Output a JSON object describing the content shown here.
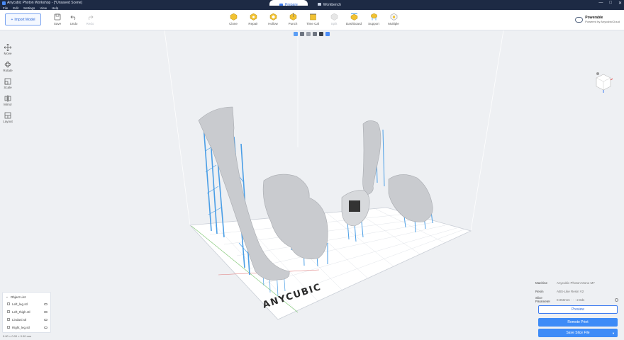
{
  "window": {
    "title": "Anycubic Photon Workshop - [*Unsaved Scene]",
    "tabs": [
      {
        "label": "Prepare",
        "active": true
      },
      {
        "label": "Workbench",
        "active": false
      }
    ],
    "controls": [
      "—",
      "□",
      "✕"
    ]
  },
  "menu": [
    "File",
    "Edit",
    "Settings",
    "View",
    "Help"
  ],
  "toolbar": {
    "import_label": "Import Model",
    "left_tools": [
      {
        "label": "Save",
        "icon": "save-icon",
        "enabled": true
      },
      {
        "label": "Undo",
        "icon": "undo-icon",
        "enabled": true
      },
      {
        "label": "Redo",
        "icon": "redo-icon",
        "enabled": false
      }
    ],
    "center_tools": [
      {
        "label": "Clone",
        "icon": "clone-icon",
        "enabled": true
      },
      {
        "label": "Repair",
        "icon": "repair-icon",
        "enabled": true
      },
      {
        "label": "Hollow",
        "icon": "hollow-icon",
        "enabled": true
      },
      {
        "label": "Punch",
        "icon": "punch-icon",
        "enabled": true
      },
      {
        "label": "Time Cal",
        "icon": "time-cal-icon",
        "enabled": true
      },
      {
        "label": "Split",
        "icon": "split-icon",
        "enabled": false
      },
      {
        "label": "Dashboard",
        "icon": "dashboard-icon",
        "enabled": true
      },
      {
        "label": "Support",
        "icon": "support-icon",
        "enabled": true
      },
      {
        "label": "Multiple",
        "icon": "multiple-icon",
        "enabled": true
      }
    ],
    "powerable_title": "Powerable",
    "powerable_sub": "Powered by AnycubicCloud"
  },
  "left_toolbar": [
    {
      "label": "Move",
      "icon": "move-icon"
    },
    {
      "label": "Rotate",
      "icon": "rotate-icon"
    },
    {
      "label": "Scale",
      "icon": "scale-icon"
    },
    {
      "label": "Mirror",
      "icon": "mirror-icon"
    },
    {
      "label": "Layout",
      "icon": "layout-icon"
    }
  ],
  "view_modes": [
    "view-mode-1",
    "view-mode-2",
    "view-mode-3",
    "view-mode-4",
    "view-mode-5",
    "view-mode-6"
  ],
  "build_plate_logo": "ANYCUBIC",
  "object_list": {
    "title": "Object List",
    "items": [
      "Left_leg.stl",
      "Left_thigh.stl",
      "Lindani.stl",
      "Right_leg.stl"
    ]
  },
  "dimensions": "0.00 × 0.00 × 0.00 mm",
  "right_panel": {
    "machine_label": "Machine",
    "machine_value": "Anycubic Photon Mono M7",
    "resin_label": "Resin",
    "resin_value": "ABS-Like Resin V2",
    "slice_label": "Slice Parameter",
    "slice_value": "0.050mm · · · 2.0ds",
    "preview_label": "Preview",
    "remote_label": "Remote Print",
    "save_label": "Save Slice File"
  },
  "colors": {
    "accent": "#3d8bf7",
    "titlebar": "#1d2a44",
    "support_blue": "#4a9ee6",
    "model_grey": "#c9cbcf"
  }
}
